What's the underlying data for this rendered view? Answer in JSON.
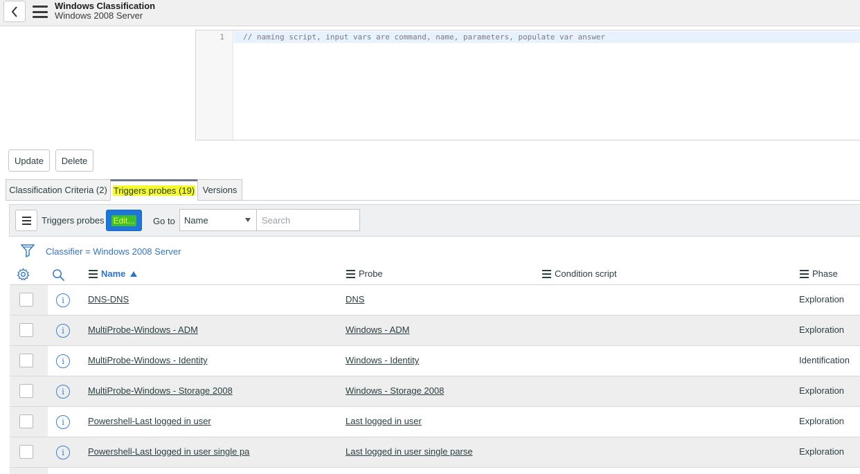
{
  "header": {
    "title": "Windows Classification",
    "subtitle": "Windows 2008 Server",
    "back_icon": "chevron-left-icon",
    "menu_icon": "hamburger-icon"
  },
  "editor": {
    "line_number": "1",
    "code": "// naming script, input vars are command, name, parameters, populate var answer"
  },
  "form_buttons": {
    "update": "Update",
    "delete": "Delete"
  },
  "tabs": [
    {
      "label": "Classification Criteria (2)",
      "active": false
    },
    {
      "label": "Triggers probes (19)",
      "active": true
    },
    {
      "label": "Versions",
      "active": false
    }
  ],
  "list": {
    "title": "Triggers probes",
    "edit_label": "Edit...",
    "goto_label": "Go to",
    "goto_selected": "Name",
    "search_placeholder": "Search",
    "filter_text": "Classifier = Windows 2008 Server",
    "columns": {
      "name": "Name",
      "probe": "Probe",
      "condition_script": "Condition script",
      "phase": "Phase"
    },
    "rows": [
      {
        "name": "DNS-DNS",
        "probe": "DNS",
        "condition": "",
        "phase": "Exploration"
      },
      {
        "name": "MultiProbe-Windows - ADM",
        "probe": "Windows - ADM",
        "condition": "",
        "phase": "Exploration"
      },
      {
        "name": "MultiProbe-Windows - Identity",
        "probe": "Windows - Identity",
        "condition": "",
        "phase": "Identification"
      },
      {
        "name": "MultiProbe-Windows - Storage 2008",
        "probe": "Windows - Storage 2008",
        "condition": "",
        "phase": "Exploration"
      },
      {
        "name": "Powershell-Last logged in user",
        "probe": "Last logged in user",
        "condition": "",
        "phase": "Exploration"
      },
      {
        "name": "Powershell-Last logged in user single pa",
        "probe": "Last logged in user single parse",
        "condition": "",
        "phase": "Exploration"
      }
    ]
  },
  "colors": {
    "accent_blue": "#2e75c4",
    "edit_button": "#1d76d8",
    "highlight_yellow": "#f6f92b"
  }
}
